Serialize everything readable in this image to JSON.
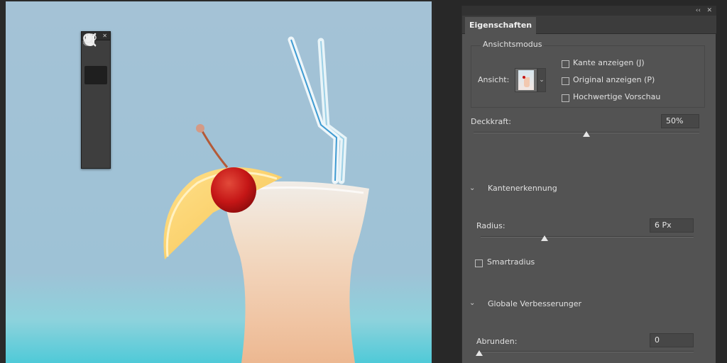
{
  "tools_panel": {
    "collapse_label": "‹‹",
    "close_label": "✕",
    "tools": [
      {
        "icon": "quick-selection-brush-icon",
        "active": false
      },
      {
        "icon": "refine-edge-brush-icon",
        "active": true
      },
      {
        "icon": "brush-icon",
        "active": false
      },
      {
        "icon": "lasso-icon",
        "active": false
      },
      {
        "icon": "hand-icon",
        "active": false
      },
      {
        "icon": "zoom-icon",
        "active": false
      }
    ]
  },
  "panel": {
    "collapse_label": "‹‹",
    "menu_label": "✕",
    "tab": "Eigenschaften",
    "view_mode": {
      "group_title": "Ansichtsmodus",
      "view_label": "Ansicht:",
      "checkboxes": [
        {
          "label": "Kante anzeigen (J)",
          "checked": false
        },
        {
          "label": "Original anzeigen (P)",
          "checked": false
        },
        {
          "label": "Hochwertige Vorschau",
          "checked": false
        }
      ]
    },
    "opacity": {
      "label": "Deckkraft:",
      "value": "50%",
      "fraction": 0.5
    },
    "edge_detection": {
      "title": "Kantenerkennung",
      "radius_label": "Radius:",
      "radius_value": "6 Px",
      "radius_fraction": 0.3,
      "smart_radius": {
        "label": "Smartradius",
        "checked": false
      }
    },
    "global_refinements": {
      "title": "Globale Verbesserunger",
      "smooth_label": "Abrunden:",
      "smooth_value": "0",
      "smooth_fraction": 0.0
    }
  },
  "colors": {
    "panel_bg": "#535353",
    "canvas_sky": "#9ec0d6",
    "cherry": "#c41414"
  }
}
